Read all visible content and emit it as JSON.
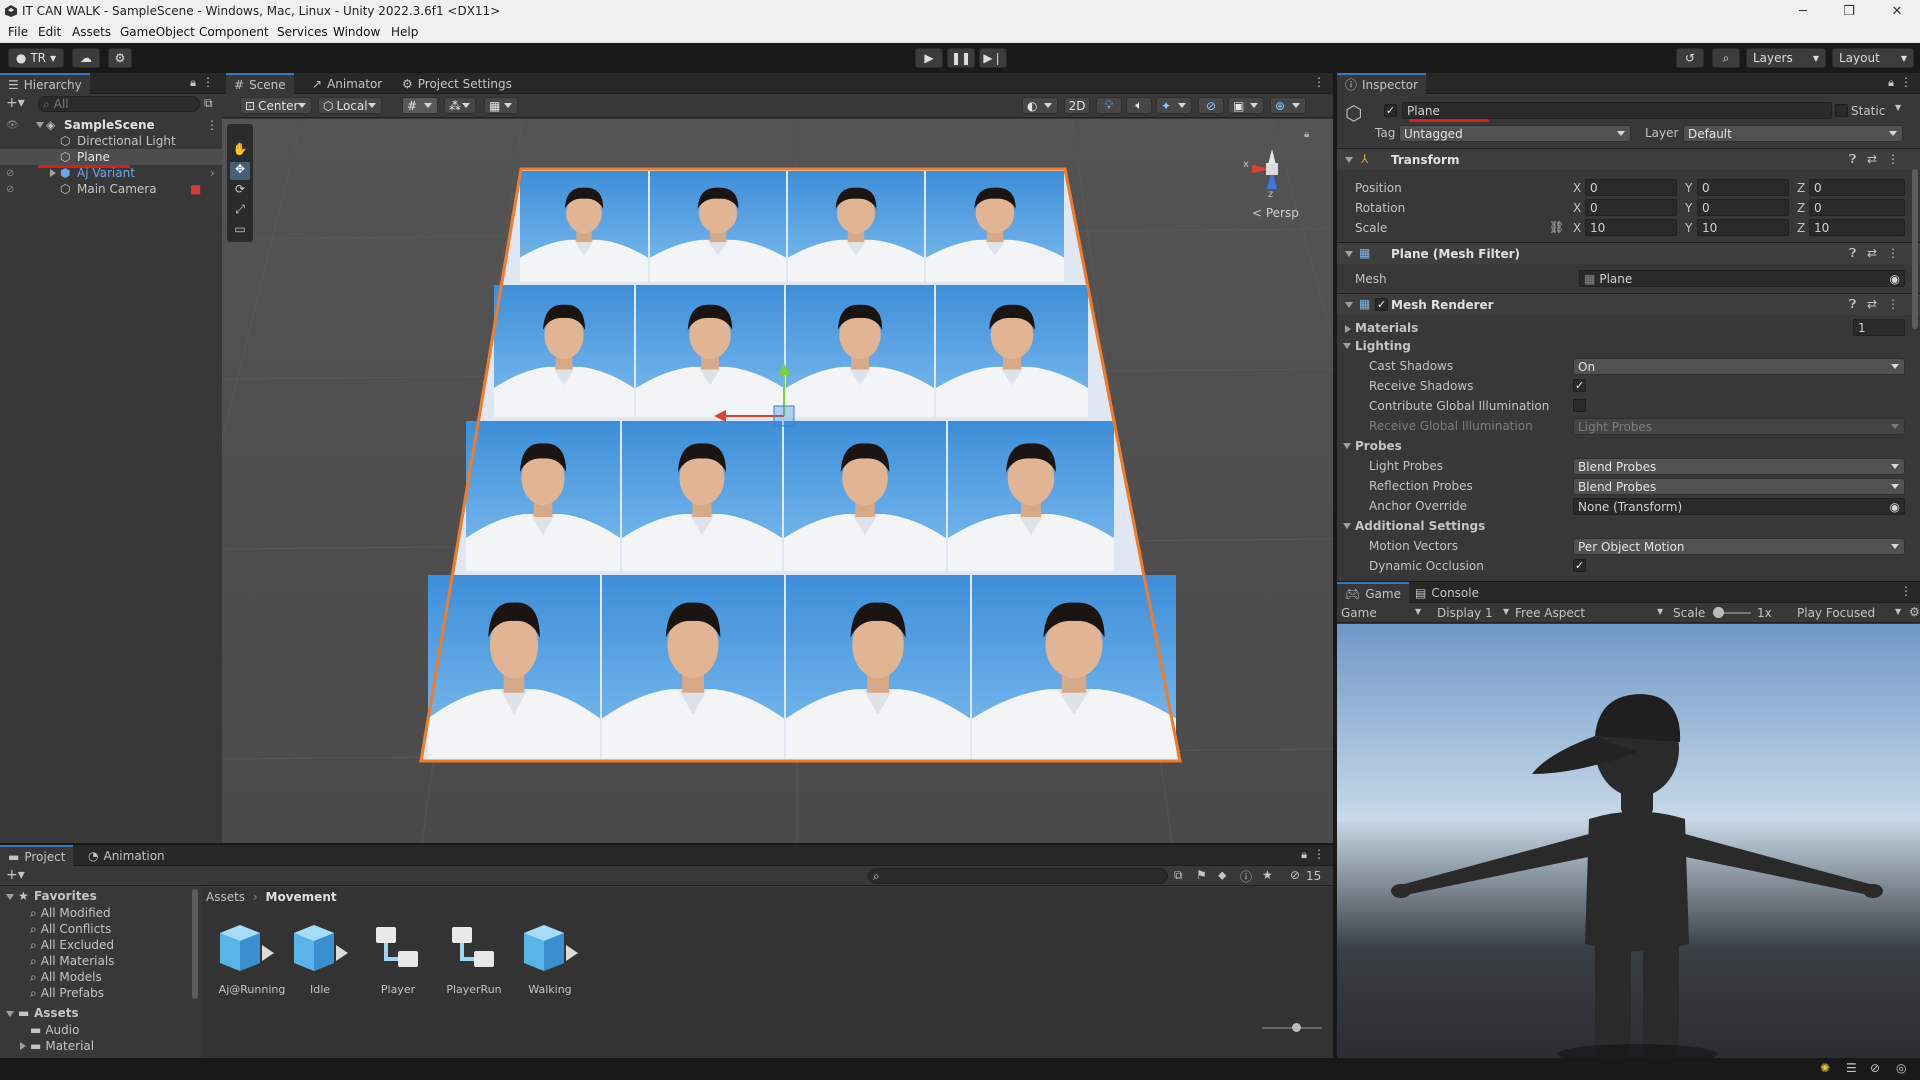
{
  "window": {
    "title": "IT CAN WALK - SampleScene - Windows, Mac, Linux - Unity 2022.3.6f1 <DX11>",
    "minimize": "─",
    "maximize": "❐",
    "close": "✕"
  },
  "menu": [
    "File",
    "Edit",
    "Assets",
    "GameObject",
    "Component",
    "Services",
    "Window",
    "Help"
  ],
  "toolbar": {
    "account": "TR",
    "layers": "Layers",
    "layout": "Layout"
  },
  "hierarchy": {
    "tab": "Hierarchy",
    "search_placeholder": "All",
    "scene": "SampleScene",
    "items": [
      {
        "label": "Directional Light"
      },
      {
        "label": "Plane"
      },
      {
        "label": "Aj Variant"
      },
      {
        "label": "Main Camera"
      }
    ]
  },
  "scene_view": {
    "tabs": [
      "Scene",
      "Animator",
      "Project Settings"
    ],
    "pivot": "Center",
    "space": "Local",
    "mode_2d": "2D",
    "persp_label": "< Persp",
    "gizmo_x": "x",
    "gizmo_z": "z"
  },
  "inspector": {
    "tab": "Inspector",
    "object_name": "Plane",
    "static_label": "Static",
    "tag_label": "Tag",
    "tag_value": "Untagged",
    "layer_label": "Layer",
    "layer_value": "Default",
    "transform": {
      "title": "Transform",
      "position_label": "Position",
      "rotation_label": "Rotation",
      "scale_label": "Scale",
      "position": {
        "x": "0",
        "y": "0",
        "z": "0"
      },
      "rotation": {
        "x": "0",
        "y": "0",
        "z": "0"
      },
      "scale": {
        "x": "10",
        "y": "10",
        "z": "10"
      }
    },
    "mesh_filter": {
      "title": "Plane (Mesh Filter)",
      "mesh_label": "Mesh",
      "mesh_value": "Plane"
    },
    "mesh_renderer": {
      "title": "Mesh Renderer",
      "materials_label": "Materials",
      "materials_count": "1",
      "lighting_label": "Lighting",
      "cast_shadows_label": "Cast Shadows",
      "cast_shadows_value": "On",
      "receive_shadows_label": "Receive Shadows",
      "contribute_gi_label": "Contribute Global Illumination",
      "receive_gi_label": "Receive Global Illumination",
      "receive_gi_value": "Light Probes",
      "probes_label": "Probes",
      "light_probes_label": "Light Probes",
      "light_probes_value": "Blend Probes",
      "reflection_probes_label": "Reflection Probes",
      "reflection_probes_value": "Blend Probes",
      "anchor_override_label": "Anchor Override",
      "anchor_override_value": "None (Transform)",
      "additional_label": "Additional Settings",
      "motion_vectors_label": "Motion Vectors",
      "motion_vectors_value": "Per Object Motion",
      "dynamic_occlusion_label": "Dynamic Occlusion"
    }
  },
  "game": {
    "tabs": [
      "Game",
      "Console"
    ],
    "mode": "Game",
    "display": "Display 1",
    "aspect": "Free Aspect",
    "scale_label": "Scale",
    "scale_value": "1x",
    "play_focused": "Play Focused"
  },
  "project": {
    "tabs": [
      "Project",
      "Animation"
    ],
    "favorites_label": "Favorites",
    "favorites": [
      "All Modified",
      "All Conflicts",
      "All Excluded",
      "All Materials",
      "All Models",
      "All Prefabs"
    ],
    "assets_label": "Assets",
    "assets_children": [
      "Audio",
      "Material"
    ],
    "breadcrumb": [
      "Assets",
      "Movement"
    ],
    "hidden_count": "15",
    "files": [
      {
        "name": "Aj@Running",
        "kind": "model"
      },
      {
        "name": "Idle",
        "kind": "model"
      },
      {
        "name": "Player",
        "kind": "controller"
      },
      {
        "name": "PlayerRun",
        "kind": "controller"
      },
      {
        "name": "Walking",
        "kind": "model"
      }
    ]
  },
  "colors": {
    "accent": "#3a79bb",
    "selection": "#2c5d87",
    "axis_x": "#e0402f",
    "axis_y": "#7bd33a",
    "axis_z": "#3a7bdc",
    "plane_outline": "#f07b2a",
    "underline_red": "#e01b1b"
  }
}
